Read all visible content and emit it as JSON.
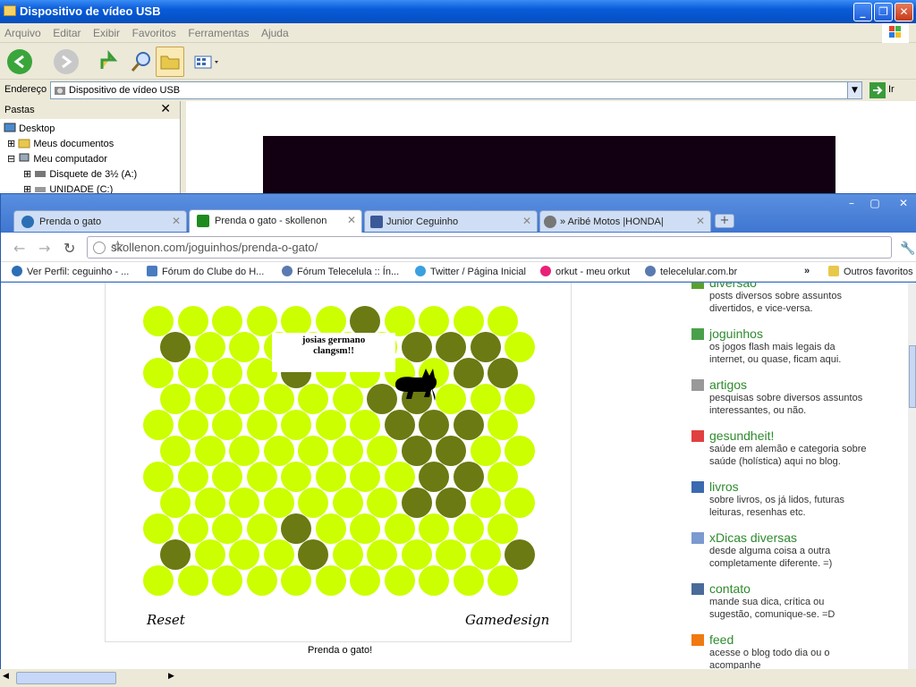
{
  "explorer": {
    "title": "Dispositivo de vídeo USB",
    "menu": [
      "Arquivo",
      "Editar",
      "Exibir",
      "Favoritos",
      "Ferramentas",
      "Ajuda"
    ],
    "address_label": "Endereço",
    "address_value": "Dispositivo de vídeo USB",
    "go_label": "Ir",
    "folders_header": "Pastas",
    "tree": [
      "Desktop",
      "Meus documentos",
      "Meu computador",
      "Disquete de 3½ (A:)",
      "UNIDADE (C:)"
    ]
  },
  "chrome": {
    "tabs": [
      {
        "label": "Prenda o gato",
        "color": "#2c6fb5"
      },
      {
        "label": "Prenda o gato - skollenon",
        "color": "#1e8b1e"
      },
      {
        "label": "Junior Ceguinho",
        "color": "#3b5998"
      },
      {
        "label": "» Aribé Motos |HONDA|",
        "color": "#777777"
      }
    ],
    "url": "skollenon.com/joguinhos/prenda-o-gato/",
    "bookmarks": [
      "Ver Perfil: ceguinho - ...",
      "Fórum do Clube do H...",
      "Fórum Telecelula :: Ín...",
      "Twitter / Página Inicial",
      "orkut - meu orkut",
      "telecelular.com.br"
    ],
    "bookmarks_more": "»",
    "other_bookmarks": "Outros favoritos"
  },
  "game": {
    "bubble_line1": "josias germano",
    "bubble_line2": "clangsm!!",
    "reset": "Reset",
    "gamedesign": "Gamedesign",
    "caption": "Prenda o gato!",
    "colors": {
      "light": "#ccff00",
      "dark": "#6b7a12"
    }
  },
  "sidebar": [
    {
      "title": "diversão",
      "desc": "posts diversos sobre assuntos divertidos, e vice-versa.",
      "icon": "#5aa02c"
    },
    {
      "title": "joguinhos",
      "desc": "os jogos flash mais legais da internet, ou quase, ficam aqui.",
      "icon": "#4aa04a"
    },
    {
      "title": "artigos",
      "desc": "pesquisas sobre diversos assuntos interessantes, ou não.",
      "icon": "#999999"
    },
    {
      "title": "gesundheit!",
      "desc": "saúde em alemão e categoria sobre saúde (holística) aqui no blog.",
      "icon": "#e04040"
    },
    {
      "title": "livros",
      "desc": "sobre livros, os já lidos, futuras leituras, resenhas etc.",
      "icon": "#3a6ab0"
    },
    {
      "title": "xDicas diversas",
      "desc": "desde alguma coisa a outra completamente diferente. =)",
      "icon": "#7a9ad0"
    },
    {
      "title": "contato",
      "desc": "mande sua dica, crítica ou sugestão, comunique-se. =D",
      "icon": "#4a6a9a"
    },
    {
      "title": "feed",
      "desc": "acesse o blog todo dia ou o acompanhe",
      "icon": "#f07a10"
    }
  ]
}
